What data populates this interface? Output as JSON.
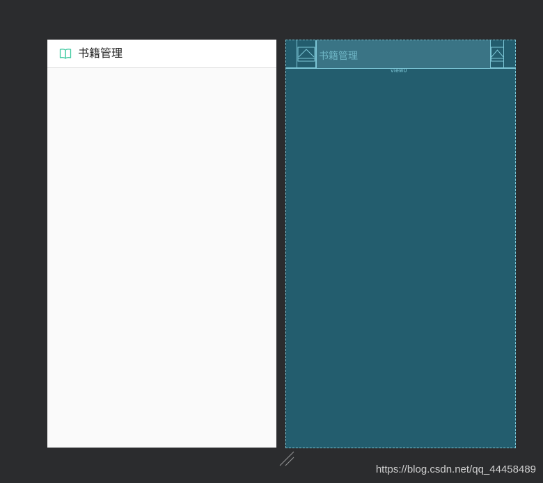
{
  "design_preview": {
    "toolbar": {
      "icon": "open-book-icon",
      "title": "书籍管理"
    }
  },
  "blueprint_preview": {
    "toolbar": {
      "title": "书籍管理",
      "view_label": "view0"
    }
  },
  "watermark": "https://blog.csdn.net/qq_44458489",
  "colors": {
    "background": "#2b2c2e",
    "design_surface": "#fafafa",
    "blueprint_surface": "#235d6e",
    "blueprint_line": "#7cc6d6",
    "icon_accent": "#3ec9a0"
  }
}
